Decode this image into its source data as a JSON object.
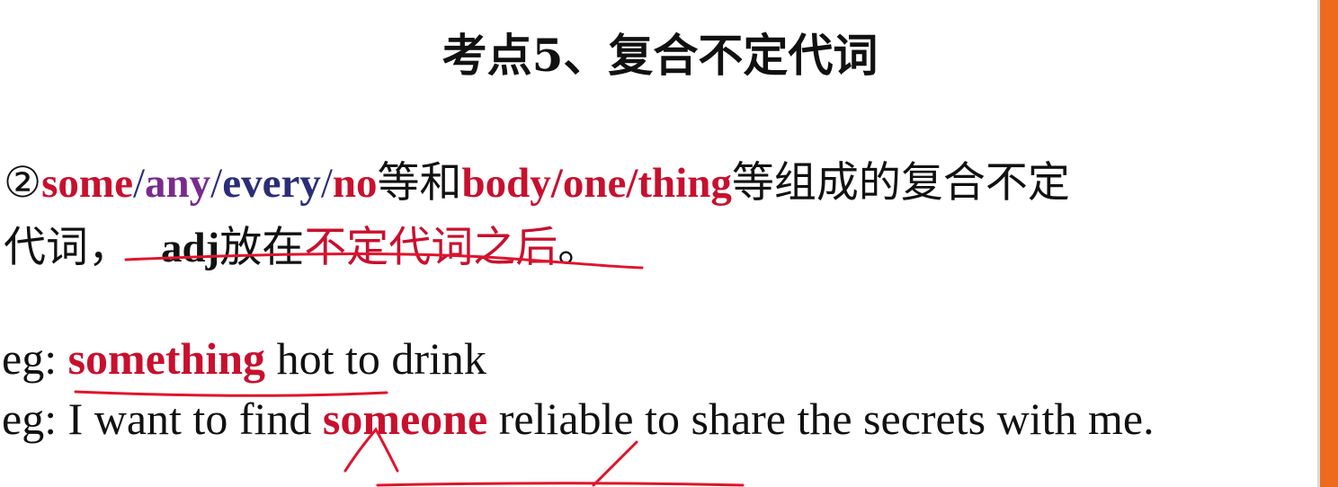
{
  "title": "考点5、复合不定代词",
  "rule": {
    "marker": "②",
    "some": "some",
    "slash1": "/",
    "any": "any",
    "slash2": "/",
    "every": "every",
    "slash3": "/",
    "no": "no",
    "connector": "等和",
    "roots": "body/one/thing",
    "rest1": "等组成的复合不定",
    "line2_prefix": "代词，",
    "adj": "adj",
    "verb": "放在",
    "position": "不定代词之后",
    "period": "。"
  },
  "examples": [
    {
      "prefix": "eg: ",
      "keyword": "something",
      "rest": " hot to drink"
    },
    {
      "prefix": "eg: I want to find ",
      "keyword": "someone",
      "rest": " reliable to share the secrets with me."
    }
  ],
  "colors": {
    "red": "#c8102e",
    "purple": "#7a2a8e",
    "navy": "#2b2d78",
    "accent": "#ee6a1e",
    "ink": "#e0142c"
  }
}
